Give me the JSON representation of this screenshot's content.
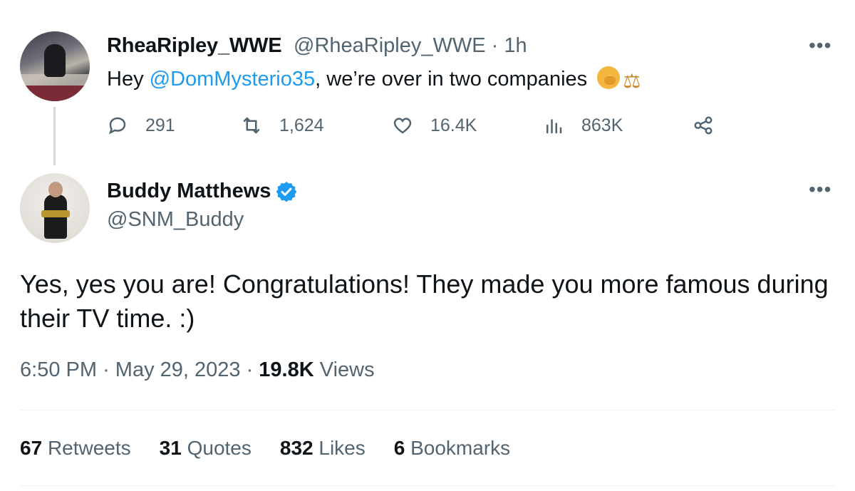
{
  "parent_tweet": {
    "display_name": "RheaRipley_WWE",
    "handle_time": "@RheaRipley_WWE · 1h",
    "text_prefix": "Hey ",
    "mention": "@DomMysterio35",
    "text_suffix": ", we’re over in two companies",
    "emojis": [
      "face-with-hand-over-mouth-emoji",
      "scales-emoji"
    ],
    "actions": {
      "replies": "291",
      "retweets": "1,624",
      "likes": "16.4K",
      "views": "863K"
    }
  },
  "main_tweet": {
    "display_name": "Buddy Matthews",
    "verified": true,
    "handle": "@SNM_Buddy",
    "text": "Yes, yes you are! Congratulations! They made you more famous during their TV time.  :)",
    "time": "6:50 PM",
    "date": "May 29, 2023",
    "views_count": "19.8K",
    "views_label": "Views",
    "stats": [
      {
        "count": "67",
        "label": "Retweets"
      },
      {
        "count": "31",
        "label": "Quotes"
      },
      {
        "count": "832",
        "label": "Likes"
      },
      {
        "count": "6",
        "label": "Bookmarks"
      }
    ]
  },
  "colors": {
    "text": "#0f1419",
    "secondary": "#536471",
    "accent": "#1d9bf0",
    "divider": "#eff3f4"
  },
  "icons": [
    "reply-icon",
    "retweet-icon",
    "like-icon",
    "views-icon",
    "share-icon",
    "more-icon",
    "verified-badge-icon"
  ]
}
